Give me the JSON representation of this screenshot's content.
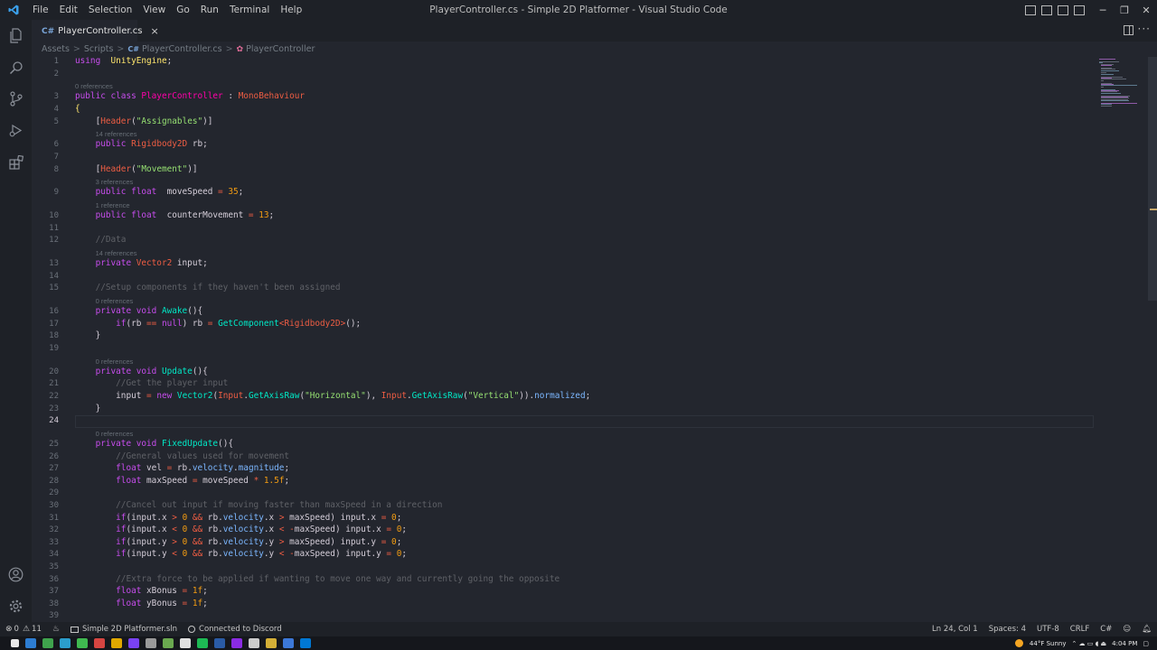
{
  "window": {
    "title": "PlayerController.cs - Simple 2D Platformer - Visual Studio Code",
    "menu": [
      "File",
      "Edit",
      "Selection",
      "View",
      "Go",
      "Run",
      "Terminal",
      "Help"
    ],
    "controls": {
      "minimize": "─",
      "restore": "❐",
      "close": "✕"
    }
  },
  "activity_bar": {
    "top_icons": [
      "explorer-icon",
      "search-icon",
      "source-control-icon",
      "run-debug-icon",
      "extensions-icon"
    ],
    "bottom_icons": [
      "accounts-icon",
      "settings-gear-icon"
    ]
  },
  "tab": {
    "icon": "C#",
    "label": "PlayerController.cs",
    "close": "×"
  },
  "breadcrumb": {
    "items": [
      "Assets",
      "Scripts",
      "PlayerController.cs",
      "PlayerController"
    ],
    "separator": ">"
  },
  "editor": {
    "active_line": 24,
    "lines": [
      {
        "n": "1",
        "tokens": [
          [
            "kw",
            "using"
          ],
          [
            "",
            "  "
          ],
          [
            "ns",
            "UnityEngine"
          ],
          [
            "",
            ";"
          ]
        ]
      },
      {
        "n": "2",
        "tokens": []
      },
      {
        "n": "3",
        "lens": "0 references",
        "tokens": [
          [
            "kw",
            "public class "
          ],
          [
            "cls",
            "PlayerController"
          ],
          [
            "",
            " : "
          ],
          [
            "ty",
            "MonoBehaviour"
          ]
        ]
      },
      {
        "n": "4",
        "tokens": [
          [
            "ns",
            "{"
          ]
        ]
      },
      {
        "n": "5",
        "tokens": [
          [
            "",
            "    ["
          ],
          [
            "ty",
            "Header"
          ],
          [
            "",
            "("
          ],
          [
            "str",
            "\"Assignables\""
          ],
          [
            "",
            ")]"
          ]
        ]
      },
      {
        "n": "6",
        "lens": "14 references",
        "tokens": [
          [
            "kw",
            "    public "
          ],
          [
            "ty",
            "Rigidbody2D"
          ],
          [
            "",
            " rb;"
          ]
        ]
      },
      {
        "n": "7",
        "tokens": []
      },
      {
        "n": "8",
        "tokens": [
          [
            "",
            "    ["
          ],
          [
            "ty",
            "Header"
          ],
          [
            "",
            "("
          ],
          [
            "str",
            "\"Movement\""
          ],
          [
            "",
            ")]"
          ]
        ]
      },
      {
        "n": "9",
        "lens": "3 references",
        "tokens": [
          [
            "kw",
            "    public float "
          ],
          [
            "",
            " moveSpeed "
          ],
          [
            "op",
            "="
          ],
          [
            "num",
            " 35"
          ],
          [
            "",
            ";"
          ]
        ]
      },
      {
        "n": "10",
        "lens": "1 reference",
        "tokens": [
          [
            "kw",
            "    public float "
          ],
          [
            "",
            " counterMovement "
          ],
          [
            "op",
            "="
          ],
          [
            "num",
            " 13"
          ],
          [
            "",
            ";"
          ]
        ]
      },
      {
        "n": "11",
        "tokens": []
      },
      {
        "n": "12",
        "tokens": [
          [
            "com",
            "    //Data"
          ]
        ]
      },
      {
        "n": "13",
        "lens": "14 references",
        "tokens": [
          [
            "kw",
            "    private "
          ],
          [
            "ty",
            "Vector2"
          ],
          [
            "",
            " input;"
          ]
        ]
      },
      {
        "n": "14",
        "tokens": []
      },
      {
        "n": "15",
        "tokens": [
          [
            "com",
            "    //Setup components if they haven't been assigned"
          ]
        ]
      },
      {
        "n": "16",
        "lens": "0 references",
        "tokens": [
          [
            "kw",
            "    private void "
          ],
          [
            "fnc",
            "Awake"
          ],
          [
            "",
            "(){"
          ]
        ]
      },
      {
        "n": "17",
        "tokens": [
          [
            "kw",
            "        if"
          ],
          [
            "",
            "(rb "
          ],
          [
            "op",
            "=="
          ],
          [
            "kw",
            " null"
          ],
          [
            "",
            ") rb "
          ],
          [
            "op",
            "="
          ],
          [
            "fnc",
            " GetComponent"
          ],
          [
            "op",
            "<"
          ],
          [
            "ty",
            "Rigidbody2D"
          ],
          [
            "op",
            ">"
          ],
          [
            "",
            "();"
          ]
        ]
      },
      {
        "n": "18",
        "tokens": [
          [
            "",
            "    }"
          ]
        ]
      },
      {
        "n": "19",
        "tokens": []
      },
      {
        "n": "20",
        "lens": "0 references",
        "tokens": [
          [
            "kw",
            "    private void "
          ],
          [
            "fnc",
            "Update"
          ],
          [
            "",
            "(){"
          ]
        ]
      },
      {
        "n": "21",
        "tokens": [
          [
            "com",
            "        //Get the player input"
          ]
        ]
      },
      {
        "n": "22",
        "tokens": [
          [
            "",
            "        input "
          ],
          [
            "op",
            "="
          ],
          [
            "kw",
            " new "
          ],
          [
            "fnc",
            "Vector2"
          ],
          [
            "",
            "("
          ],
          [
            "ty",
            "Input"
          ],
          [
            "",
            "."
          ],
          [
            "fnc",
            "GetAxisRaw"
          ],
          [
            "",
            "("
          ],
          [
            "str",
            "\"Horizontal\""
          ],
          [
            "",
            "), "
          ],
          [
            "ty",
            "Input"
          ],
          [
            "",
            "."
          ],
          [
            "fnc",
            "GetAxisRaw"
          ],
          [
            "",
            "("
          ],
          [
            "str",
            "\"Vertical\""
          ],
          [
            "",
            "))."
          ],
          [
            "fn",
            "normalized"
          ],
          [
            "",
            ";"
          ]
        ]
      },
      {
        "n": "23",
        "tokens": [
          [
            "",
            "    }"
          ]
        ]
      },
      {
        "n": "24",
        "tokens": []
      },
      {
        "n": "25",
        "lens": "0 references",
        "tokens": [
          [
            "kw",
            "    private void "
          ],
          [
            "fnc",
            "FixedUpdate"
          ],
          [
            "",
            "(){"
          ]
        ]
      },
      {
        "n": "26",
        "tokens": [
          [
            "com",
            "        //General values used for movement"
          ]
        ]
      },
      {
        "n": "27",
        "tokens": [
          [
            "kw",
            "        float "
          ],
          [
            "",
            "vel "
          ],
          [
            "op",
            "="
          ],
          [
            "",
            " rb."
          ],
          [
            "fn",
            "velocity"
          ],
          [
            "",
            "."
          ],
          [
            "fn",
            "magnitude"
          ],
          [
            "",
            ";"
          ]
        ]
      },
      {
        "n": "28",
        "tokens": [
          [
            "kw",
            "        float "
          ],
          [
            "",
            "maxSpeed "
          ],
          [
            "op",
            "="
          ],
          [
            "",
            " moveSpeed "
          ],
          [
            "op",
            "*"
          ],
          [
            "num",
            " 1.5f"
          ],
          [
            "",
            ";"
          ]
        ]
      },
      {
        "n": "29",
        "tokens": []
      },
      {
        "n": "30",
        "tokens": [
          [
            "com",
            "        //Cancel out input if moving faster than maxSpeed in a direction"
          ]
        ]
      },
      {
        "n": "31",
        "tokens": [
          [
            "kw",
            "        if"
          ],
          [
            "",
            "(input.x "
          ],
          [
            "op",
            ">"
          ],
          [
            "num",
            " 0 "
          ],
          [
            "op",
            "&&"
          ],
          [
            "",
            " rb."
          ],
          [
            "fn",
            "velocity"
          ],
          [
            "",
            ".x "
          ],
          [
            "op",
            ">"
          ],
          [
            "",
            " maxSpeed) input.x "
          ],
          [
            "op",
            "="
          ],
          [
            "num",
            " 0"
          ],
          [
            "",
            ";"
          ]
        ]
      },
      {
        "n": "32",
        "tokens": [
          [
            "kw",
            "        if"
          ],
          [
            "",
            "(input.x "
          ],
          [
            "op",
            "<"
          ],
          [
            "num",
            " 0 "
          ],
          [
            "op",
            "&&"
          ],
          [
            "",
            " rb."
          ],
          [
            "fn",
            "velocity"
          ],
          [
            "",
            ".x "
          ],
          [
            "op",
            "<"
          ],
          [
            "",
            " "
          ],
          [
            "op",
            "-"
          ],
          [
            "",
            "maxSpeed) input.x "
          ],
          [
            "op",
            "="
          ],
          [
            "num",
            " 0"
          ],
          [
            "",
            ";"
          ]
        ]
      },
      {
        "n": "33",
        "tokens": [
          [
            "kw",
            "        if"
          ],
          [
            "",
            "(input.y "
          ],
          [
            "op",
            ">"
          ],
          [
            "num",
            " 0 "
          ],
          [
            "op",
            "&&"
          ],
          [
            "",
            " rb."
          ],
          [
            "fn",
            "velocity"
          ],
          [
            "",
            ".y "
          ],
          [
            "op",
            ">"
          ],
          [
            "",
            " maxSpeed) input.y "
          ],
          [
            "op",
            "="
          ],
          [
            "num",
            " 0"
          ],
          [
            "",
            ";"
          ]
        ]
      },
      {
        "n": "34",
        "tokens": [
          [
            "kw",
            "        if"
          ],
          [
            "",
            "(input.y "
          ],
          [
            "op",
            "<"
          ],
          [
            "num",
            " 0 "
          ],
          [
            "op",
            "&&"
          ],
          [
            "",
            " rb."
          ],
          [
            "fn",
            "velocity"
          ],
          [
            "",
            ".y "
          ],
          [
            "op",
            "<"
          ],
          [
            "",
            " "
          ],
          [
            "op",
            "-"
          ],
          [
            "",
            "maxSpeed) input.y "
          ],
          [
            "op",
            "="
          ],
          [
            "num",
            " 0"
          ],
          [
            "",
            ";"
          ]
        ]
      },
      {
        "n": "35",
        "tokens": []
      },
      {
        "n": "36",
        "tokens": [
          [
            "com",
            "        //Extra force to be applied if wanting to move one way and currently going the opposite"
          ]
        ]
      },
      {
        "n": "37",
        "tokens": [
          [
            "kw",
            "        float "
          ],
          [
            "",
            "xBonus "
          ],
          [
            "op",
            "="
          ],
          [
            "num",
            " 1f"
          ],
          [
            "",
            ";"
          ]
        ]
      },
      {
        "n": "38",
        "tokens": [
          [
            "kw",
            "        float "
          ],
          [
            "",
            "yBonus "
          ],
          [
            "op",
            "="
          ],
          [
            "num",
            " 1f"
          ],
          [
            "",
            ";"
          ]
        ]
      },
      {
        "n": "39",
        "tokens": []
      }
    ]
  },
  "status_bar": {
    "errors": "0",
    "warnings": "11",
    "solution": "Simple 2D Platformer.sln",
    "discord": "Connected to Discord",
    "cursor": "Ln 24, Col 1",
    "spaces": "Spaces: 4",
    "encoding": "UTF-8",
    "eol": "CRLF",
    "language": "C#"
  },
  "taskbar": {
    "weather": "44°F  Sunny",
    "time": "4:04 PM",
    "icon_colors": [
      "#2d7dd2",
      "#3fa34d",
      "#2b9dcc",
      "#3fb950",
      "#d64541",
      "#e0a800",
      "#7a42f4",
      "#9a9a9a",
      "#6aa84f",
      "#e0e0e0",
      "#1db954",
      "#2a5ba5",
      "#8a2be2",
      "#cccccc",
      "#d4af37",
      "#3c78d8",
      "#0078d4"
    ]
  },
  "colors": {
    "bg": "#23262e",
    "chrome": "#1e2127",
    "accent": "#0078d4"
  }
}
